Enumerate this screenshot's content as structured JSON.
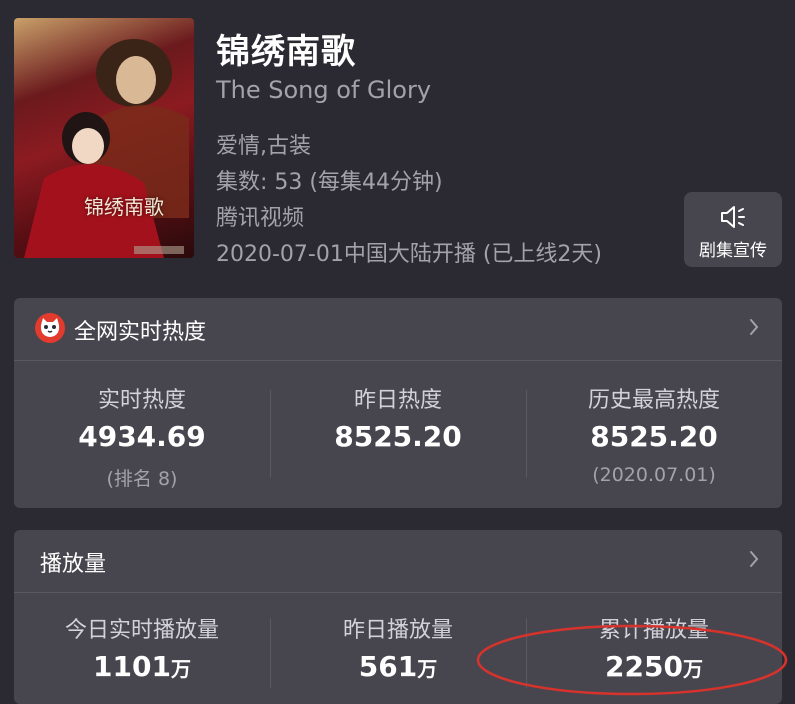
{
  "poster": {
    "title_text": "锦绣南歌"
  },
  "show": {
    "title": "锦绣南歌",
    "subtitle": "The Song of Glory",
    "genre": "爱情,古装",
    "episodes": "集数: 53   (每集44分钟)",
    "platform": "腾讯视频",
    "premiere": "2020-07-01中国大陆开播 (已上线2天)"
  },
  "promo": {
    "label": "剧集宣传",
    "icon": "speaker-icon"
  },
  "heat": {
    "header": "全网实时热度",
    "stats": [
      {
        "label": "实时热度",
        "value": "4934.69",
        "sub": "(排名 8)"
      },
      {
        "label": "昨日热度",
        "value": "8525.20",
        "sub": ""
      },
      {
        "label": "历史最高热度",
        "value": "8525.20",
        "sub": "(2020.07.01)"
      }
    ]
  },
  "plays": {
    "header": "播放量",
    "unit": "万",
    "stats": [
      {
        "label": "今日实时播放量",
        "value": "1101"
      },
      {
        "label": "昨日播放量",
        "value": "561"
      },
      {
        "label": "累计播放量",
        "value": "2250"
      }
    ]
  },
  "colors": {
    "background": "#2b2a33",
    "card": "#47464f",
    "muted": "#a3a2aa",
    "annotation": "#d8322c"
  }
}
